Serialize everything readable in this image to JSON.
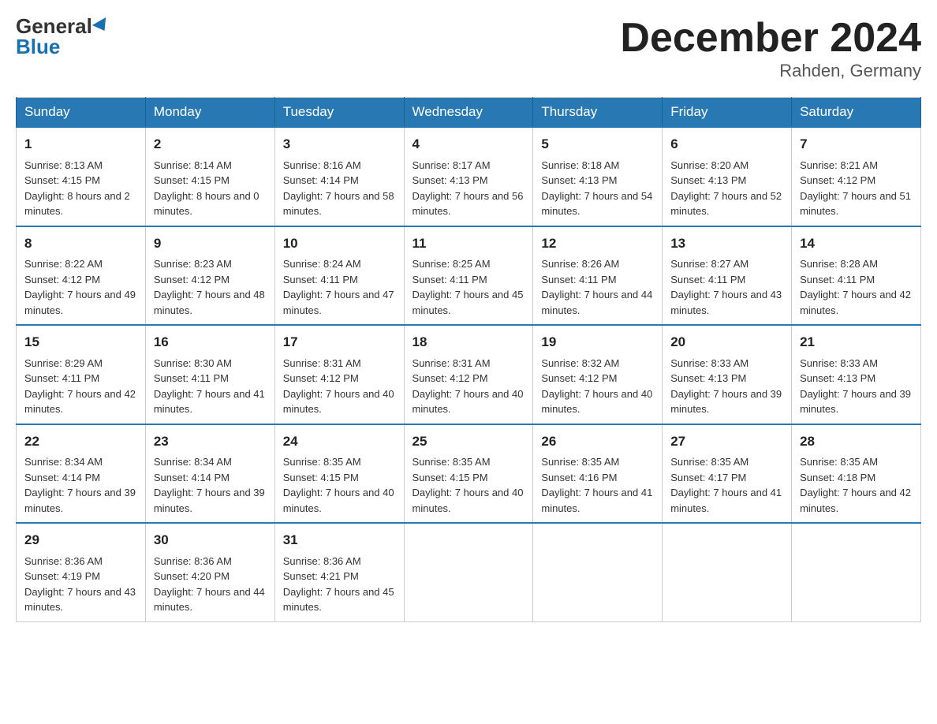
{
  "header": {
    "logo_general": "General",
    "logo_blue": "Blue",
    "month_title": "December 2024",
    "location": "Rahden, Germany"
  },
  "weekdays": [
    "Sunday",
    "Monday",
    "Tuesday",
    "Wednesday",
    "Thursday",
    "Friday",
    "Saturday"
  ],
  "weeks": [
    [
      {
        "day": "1",
        "sunrise": "8:13 AM",
        "sunset": "4:15 PM",
        "daylight": "8 hours and 2 minutes."
      },
      {
        "day": "2",
        "sunrise": "8:14 AM",
        "sunset": "4:15 PM",
        "daylight": "8 hours and 0 minutes."
      },
      {
        "day": "3",
        "sunrise": "8:16 AM",
        "sunset": "4:14 PM",
        "daylight": "7 hours and 58 minutes."
      },
      {
        "day": "4",
        "sunrise": "8:17 AM",
        "sunset": "4:13 PM",
        "daylight": "7 hours and 56 minutes."
      },
      {
        "day": "5",
        "sunrise": "8:18 AM",
        "sunset": "4:13 PM",
        "daylight": "7 hours and 54 minutes."
      },
      {
        "day": "6",
        "sunrise": "8:20 AM",
        "sunset": "4:13 PM",
        "daylight": "7 hours and 52 minutes."
      },
      {
        "day": "7",
        "sunrise": "8:21 AM",
        "sunset": "4:12 PM",
        "daylight": "7 hours and 51 minutes."
      }
    ],
    [
      {
        "day": "8",
        "sunrise": "8:22 AM",
        "sunset": "4:12 PM",
        "daylight": "7 hours and 49 minutes."
      },
      {
        "day": "9",
        "sunrise": "8:23 AM",
        "sunset": "4:12 PM",
        "daylight": "7 hours and 48 minutes."
      },
      {
        "day": "10",
        "sunrise": "8:24 AM",
        "sunset": "4:11 PM",
        "daylight": "7 hours and 47 minutes."
      },
      {
        "day": "11",
        "sunrise": "8:25 AM",
        "sunset": "4:11 PM",
        "daylight": "7 hours and 45 minutes."
      },
      {
        "day": "12",
        "sunrise": "8:26 AM",
        "sunset": "4:11 PM",
        "daylight": "7 hours and 44 minutes."
      },
      {
        "day": "13",
        "sunrise": "8:27 AM",
        "sunset": "4:11 PM",
        "daylight": "7 hours and 43 minutes."
      },
      {
        "day": "14",
        "sunrise": "8:28 AM",
        "sunset": "4:11 PM",
        "daylight": "7 hours and 42 minutes."
      }
    ],
    [
      {
        "day": "15",
        "sunrise": "8:29 AM",
        "sunset": "4:11 PM",
        "daylight": "7 hours and 42 minutes."
      },
      {
        "day": "16",
        "sunrise": "8:30 AM",
        "sunset": "4:11 PM",
        "daylight": "7 hours and 41 minutes."
      },
      {
        "day": "17",
        "sunrise": "8:31 AM",
        "sunset": "4:12 PM",
        "daylight": "7 hours and 40 minutes."
      },
      {
        "day": "18",
        "sunrise": "8:31 AM",
        "sunset": "4:12 PM",
        "daylight": "7 hours and 40 minutes."
      },
      {
        "day": "19",
        "sunrise": "8:32 AM",
        "sunset": "4:12 PM",
        "daylight": "7 hours and 40 minutes."
      },
      {
        "day": "20",
        "sunrise": "8:33 AM",
        "sunset": "4:13 PM",
        "daylight": "7 hours and 39 minutes."
      },
      {
        "day": "21",
        "sunrise": "8:33 AM",
        "sunset": "4:13 PM",
        "daylight": "7 hours and 39 minutes."
      }
    ],
    [
      {
        "day": "22",
        "sunrise": "8:34 AM",
        "sunset": "4:14 PM",
        "daylight": "7 hours and 39 minutes."
      },
      {
        "day": "23",
        "sunrise": "8:34 AM",
        "sunset": "4:14 PM",
        "daylight": "7 hours and 39 minutes."
      },
      {
        "day": "24",
        "sunrise": "8:35 AM",
        "sunset": "4:15 PM",
        "daylight": "7 hours and 40 minutes."
      },
      {
        "day": "25",
        "sunrise": "8:35 AM",
        "sunset": "4:15 PM",
        "daylight": "7 hours and 40 minutes."
      },
      {
        "day": "26",
        "sunrise": "8:35 AM",
        "sunset": "4:16 PM",
        "daylight": "7 hours and 41 minutes."
      },
      {
        "day": "27",
        "sunrise": "8:35 AM",
        "sunset": "4:17 PM",
        "daylight": "7 hours and 41 minutes."
      },
      {
        "day": "28",
        "sunrise": "8:35 AM",
        "sunset": "4:18 PM",
        "daylight": "7 hours and 42 minutes."
      }
    ],
    [
      {
        "day": "29",
        "sunrise": "8:36 AM",
        "sunset": "4:19 PM",
        "daylight": "7 hours and 43 minutes."
      },
      {
        "day": "30",
        "sunrise": "8:36 AM",
        "sunset": "4:20 PM",
        "daylight": "7 hours and 44 minutes."
      },
      {
        "day": "31",
        "sunrise": "8:36 AM",
        "sunset": "4:21 PM",
        "daylight": "7 hours and 45 minutes."
      },
      null,
      null,
      null,
      null
    ]
  ]
}
